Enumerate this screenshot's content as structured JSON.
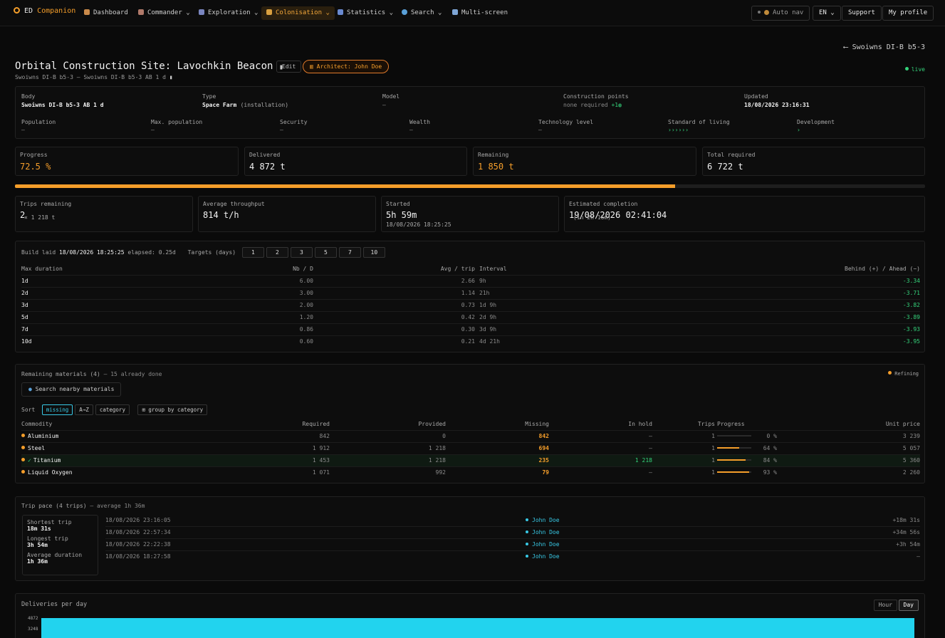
{
  "nav": {
    "brand_prefix": "ED",
    "brand_name": "Companion",
    "items": [
      {
        "label": "Dashboard",
        "icon": "home-icon"
      },
      {
        "label": "Commander",
        "icon": "person-icon"
      },
      {
        "label": "Exploration",
        "icon": "telescope-icon"
      },
      {
        "label": "Colonisation",
        "icon": "rocket-icon"
      },
      {
        "label": "Statistics",
        "icon": "bar-chart-icon"
      },
      {
        "label": "Search",
        "icon": "search-icon"
      },
      {
        "label": "Multi-screen",
        "icon": "monitor-icon"
      }
    ],
    "auto_nav": "Auto nav",
    "language": "EN",
    "support": "Support",
    "profile": "My profile"
  },
  "header": {
    "back_label": "Swoiwns DI-B b5-3",
    "title": "Orbital Construction Site: Lavochkin Beacon",
    "edit": "Edit",
    "architect": "Architect: John Doe",
    "subtitle": "Swoiwns DI-B b5-3 — Swoiwns DI-B b5-3 AB 1 d",
    "live": "live"
  },
  "info": {
    "body_label": "Body",
    "body": "Swoiwns DI-B b5-3 AB 1 d",
    "type_label": "Type",
    "type": "Space Farm",
    "type_suffix": "(installation)",
    "model_label": "Model",
    "model": "—",
    "cp_label": "Construction points",
    "cp_value": "none required",
    "cp_plus": "+1",
    "updated_label": "Updated",
    "updated": "18/08/2026 23:16:31",
    "population_label": "Population",
    "population": "—",
    "maxpop_label": "Max. population",
    "maxpop": "—",
    "security_label": "Security",
    "security": "—",
    "wealth_label": "Wealth",
    "wealth": "—",
    "tech_label": "Technology level",
    "tech": "—",
    "sol_label": "Standard of living",
    "sol": "››››››",
    "dev_label": "Development",
    "dev": "›"
  },
  "stats": {
    "progress_label": "Progress",
    "progress": "72.5 %",
    "delivered_label": "Delivered",
    "delivered": "4 872 t",
    "remaining_label": "Remaining",
    "remaining": "1 850 t",
    "total_label": "Total required",
    "total": "6 722 t",
    "progress_fraction": 0.725
  },
  "stats2": {
    "trips_label": "Trips remaining",
    "trips": "2",
    "trips_detail": "× 1 218 t",
    "throughput_label": "Average throughput",
    "throughput": "814 t/h",
    "started_label": "Started",
    "started": "5h 59m",
    "started_date": "18/08/2026 18:25:25",
    "eta_label": "Estimated completion",
    "eta": "19/08/2026 02:41:04",
    "eta_detail": "(in 2h 16m)"
  },
  "targets": {
    "build_label": "Build laid",
    "build_date": "18/08/2026 18:25:25",
    "elapsed": "elapsed: 0.25d",
    "targets_label": "Targets (days)",
    "buttons": [
      "1",
      "2",
      "3",
      "5",
      "7",
      "10"
    ],
    "headers": [
      "Max duration",
      "Nb / D",
      "Avg / trip",
      "Interval",
      "Behind (+) / Ahead (−)"
    ],
    "rows": [
      {
        "max": "1d",
        "nb": "6.00",
        "avg": "2.66",
        "interval": "9h",
        "delta": "-3.34"
      },
      {
        "max": "2d",
        "nb": "3.00",
        "avg": "1.14",
        "interval": "21h",
        "delta": "-3.71"
      },
      {
        "max": "3d",
        "nb": "2.00",
        "avg": "0.73",
        "interval": "1d 9h",
        "delta": "-3.82"
      },
      {
        "max": "5d",
        "nb": "1.20",
        "avg": "0.42",
        "interval": "2d 9h",
        "delta": "-3.89"
      },
      {
        "max": "7d",
        "nb": "0.86",
        "avg": "0.30",
        "interval": "3d 9h",
        "delta": "-3.93"
      },
      {
        "max": "10d",
        "nb": "0.60",
        "avg": "0.21",
        "interval": "4d 21h",
        "delta": "-3.95"
      }
    ]
  },
  "materials": {
    "title": "Remaining materials (4)",
    "done": "— 15 already done",
    "refining": "Refining",
    "search": "Search nearby materials",
    "sort_label": "Sort",
    "sort_options": [
      "missing",
      "A→Z",
      "category"
    ],
    "group": "group by category",
    "headers": [
      "Commodity",
      "Required",
      "Provided",
      "Missing",
      "In hold",
      "Trips",
      "Progress",
      "Unit price"
    ],
    "rows": [
      {
        "name": "Aluminium",
        "required": "842",
        "provided": "0",
        "missing": "842",
        "hold": "—",
        "trips": "1",
        "pct": "0 %",
        "frac": 0.0,
        "price": "3 239",
        "check": ""
      },
      {
        "name": "Steel",
        "required": "1 912",
        "provided": "1 218",
        "missing": "694",
        "hold": "—",
        "trips": "1",
        "pct": "64 %",
        "frac": 0.64,
        "price": "5 057",
        "check": ""
      },
      {
        "name": "Titanium",
        "required": "1 453",
        "provided": "1 218",
        "missing": "235",
        "hold": "1 218",
        "trips": "1",
        "pct": "84 %",
        "frac": 0.84,
        "price": "5 360",
        "check": "✓"
      },
      {
        "name": "Liquid Oxygen",
        "required": "1 071",
        "provided": "992",
        "missing": "79",
        "hold": "—",
        "trips": "1",
        "pct": "93 %",
        "frac": 0.93,
        "price": "2 260",
        "check": ""
      }
    ]
  },
  "pace": {
    "title": "Trip pace (4 trips)",
    "avg": "— average 1h 36m",
    "shortest_label": "Shortest trip",
    "shortest": "18m 31s",
    "longest_label": "Longest trip",
    "longest": "3h 54m",
    "average_label": "Average duration",
    "average": "1h 36m",
    "rows": [
      {
        "date": "18/08/2026 23:16:05",
        "cmdr": "John Doe",
        "delta": "+18m 31s"
      },
      {
        "date": "18/08/2026 22:57:34",
        "cmdr": "John Doe",
        "delta": "+34m 56s"
      },
      {
        "date": "18/08/2026 22:22:38",
        "cmdr": "John Doe",
        "delta": "+3h 54m"
      },
      {
        "date": "18/08/2026 18:27:58",
        "cmdr": "John Doe",
        "delta": "—"
      }
    ]
  },
  "deliveries": {
    "title": "Deliveries per day",
    "hour": "Hour",
    "day": "Day",
    "y_ticks": [
      "4872",
      "3248"
    ]
  },
  "colors": {
    "accent": "#f59e2a",
    "positive": "#34d27a",
    "cyan": "#38c9e6",
    "bar": "#22d3ee"
  }
}
